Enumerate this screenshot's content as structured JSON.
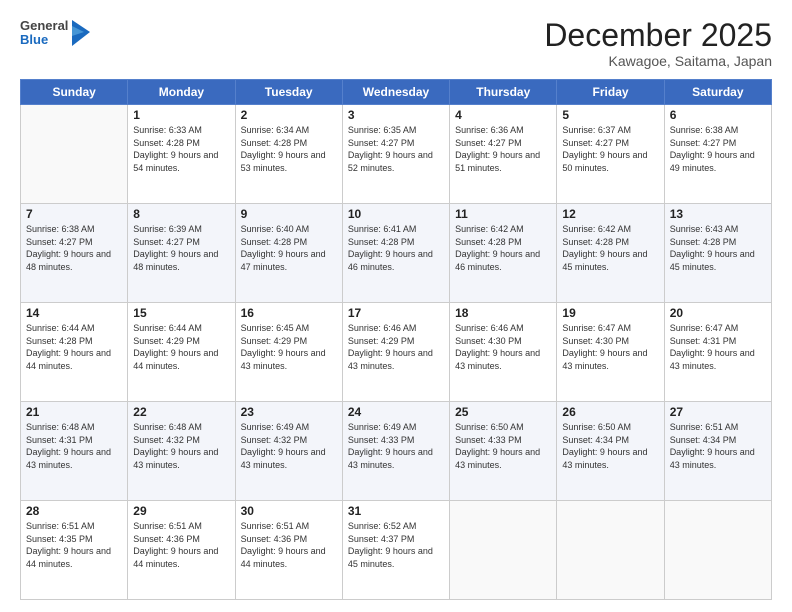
{
  "header": {
    "logo_general": "General",
    "logo_blue": "Blue",
    "title": "December 2025",
    "location": "Kawagoe, Saitama, Japan"
  },
  "days_of_week": [
    "Sunday",
    "Monday",
    "Tuesday",
    "Wednesday",
    "Thursday",
    "Friday",
    "Saturday"
  ],
  "weeks": [
    [
      {
        "day": "",
        "sunrise": "",
        "sunset": "",
        "daylight": ""
      },
      {
        "day": "1",
        "sunrise": "6:33 AM",
        "sunset": "4:28 PM",
        "daylight": "9 hours and 54 minutes."
      },
      {
        "day": "2",
        "sunrise": "6:34 AM",
        "sunset": "4:28 PM",
        "daylight": "9 hours and 53 minutes."
      },
      {
        "day": "3",
        "sunrise": "6:35 AM",
        "sunset": "4:27 PM",
        "daylight": "9 hours and 52 minutes."
      },
      {
        "day": "4",
        "sunrise": "6:36 AM",
        "sunset": "4:27 PM",
        "daylight": "9 hours and 51 minutes."
      },
      {
        "day": "5",
        "sunrise": "6:37 AM",
        "sunset": "4:27 PM",
        "daylight": "9 hours and 50 minutes."
      },
      {
        "day": "6",
        "sunrise": "6:38 AM",
        "sunset": "4:27 PM",
        "daylight": "9 hours and 49 minutes."
      }
    ],
    [
      {
        "day": "7",
        "sunrise": "6:38 AM",
        "sunset": "4:27 PM",
        "daylight": "9 hours and 48 minutes."
      },
      {
        "day": "8",
        "sunrise": "6:39 AM",
        "sunset": "4:27 PM",
        "daylight": "9 hours and 48 minutes."
      },
      {
        "day": "9",
        "sunrise": "6:40 AM",
        "sunset": "4:28 PM",
        "daylight": "9 hours and 47 minutes."
      },
      {
        "day": "10",
        "sunrise": "6:41 AM",
        "sunset": "4:28 PM",
        "daylight": "9 hours and 46 minutes."
      },
      {
        "day": "11",
        "sunrise": "6:42 AM",
        "sunset": "4:28 PM",
        "daylight": "9 hours and 46 minutes."
      },
      {
        "day": "12",
        "sunrise": "6:42 AM",
        "sunset": "4:28 PM",
        "daylight": "9 hours and 45 minutes."
      },
      {
        "day": "13",
        "sunrise": "6:43 AM",
        "sunset": "4:28 PM",
        "daylight": "9 hours and 45 minutes."
      }
    ],
    [
      {
        "day": "14",
        "sunrise": "6:44 AM",
        "sunset": "4:28 PM",
        "daylight": "9 hours and 44 minutes."
      },
      {
        "day": "15",
        "sunrise": "6:44 AM",
        "sunset": "4:29 PM",
        "daylight": "9 hours and 44 minutes."
      },
      {
        "day": "16",
        "sunrise": "6:45 AM",
        "sunset": "4:29 PM",
        "daylight": "9 hours and 43 minutes."
      },
      {
        "day": "17",
        "sunrise": "6:46 AM",
        "sunset": "4:29 PM",
        "daylight": "9 hours and 43 minutes."
      },
      {
        "day": "18",
        "sunrise": "6:46 AM",
        "sunset": "4:30 PM",
        "daylight": "9 hours and 43 minutes."
      },
      {
        "day": "19",
        "sunrise": "6:47 AM",
        "sunset": "4:30 PM",
        "daylight": "9 hours and 43 minutes."
      },
      {
        "day": "20",
        "sunrise": "6:47 AM",
        "sunset": "4:31 PM",
        "daylight": "9 hours and 43 minutes."
      }
    ],
    [
      {
        "day": "21",
        "sunrise": "6:48 AM",
        "sunset": "4:31 PM",
        "daylight": "9 hours and 43 minutes."
      },
      {
        "day": "22",
        "sunrise": "6:48 AM",
        "sunset": "4:32 PM",
        "daylight": "9 hours and 43 minutes."
      },
      {
        "day": "23",
        "sunrise": "6:49 AM",
        "sunset": "4:32 PM",
        "daylight": "9 hours and 43 minutes."
      },
      {
        "day": "24",
        "sunrise": "6:49 AM",
        "sunset": "4:33 PM",
        "daylight": "9 hours and 43 minutes."
      },
      {
        "day": "25",
        "sunrise": "6:50 AM",
        "sunset": "4:33 PM",
        "daylight": "9 hours and 43 minutes."
      },
      {
        "day": "26",
        "sunrise": "6:50 AM",
        "sunset": "4:34 PM",
        "daylight": "9 hours and 43 minutes."
      },
      {
        "day": "27",
        "sunrise": "6:51 AM",
        "sunset": "4:34 PM",
        "daylight": "9 hours and 43 minutes."
      }
    ],
    [
      {
        "day": "28",
        "sunrise": "6:51 AM",
        "sunset": "4:35 PM",
        "daylight": "9 hours and 44 minutes."
      },
      {
        "day": "29",
        "sunrise": "6:51 AM",
        "sunset": "4:36 PM",
        "daylight": "9 hours and 44 minutes."
      },
      {
        "day": "30",
        "sunrise": "6:51 AM",
        "sunset": "4:36 PM",
        "daylight": "9 hours and 44 minutes."
      },
      {
        "day": "31",
        "sunrise": "6:52 AM",
        "sunset": "4:37 PM",
        "daylight": "9 hours and 45 minutes."
      },
      {
        "day": "",
        "sunrise": "",
        "sunset": "",
        "daylight": ""
      },
      {
        "day": "",
        "sunrise": "",
        "sunset": "",
        "daylight": ""
      },
      {
        "day": "",
        "sunrise": "",
        "sunset": "",
        "daylight": ""
      }
    ]
  ],
  "labels": {
    "sunrise_prefix": "Sunrise: ",
    "sunset_prefix": "Sunset: ",
    "daylight_prefix": "Daylight: "
  }
}
